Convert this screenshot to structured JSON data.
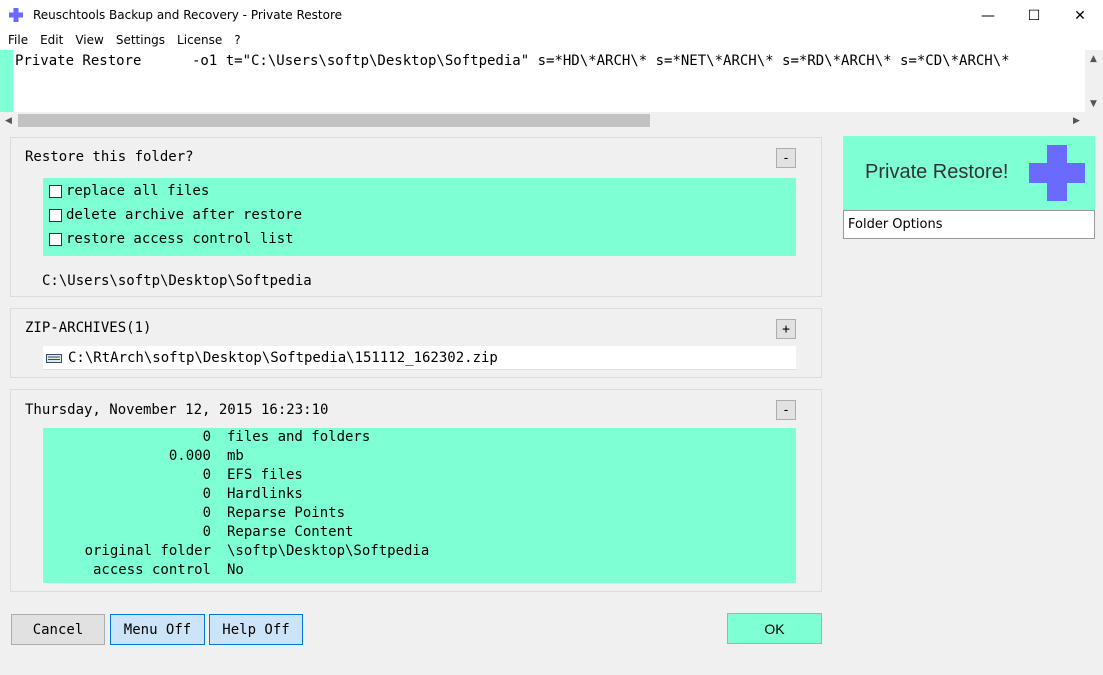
{
  "window": {
    "title": "Reuschtools Backup and Recovery - Private Restore",
    "minimize": "—",
    "maximize": "☐",
    "close": "✕"
  },
  "menu": [
    "File",
    "Edit",
    "View",
    "Settings",
    "License",
    "?"
  ],
  "command": {
    "text": "Private Restore      -o1 t=\"C:\\Users\\softp\\Desktop\\Softpedia\" s=*HD\\*ARCH\\* s=*NET\\*ARCH\\* s=*RD\\*ARCH\\* s=*CD\\*ARCH\\*"
  },
  "restore_panel": {
    "title": "Restore this folder?",
    "toggle": "-",
    "options": [
      {
        "label": "replace all files",
        "checked": false
      },
      {
        "label": "delete archive after restore",
        "checked": false
      },
      {
        "label": "restore access control list",
        "checked": false
      }
    ],
    "path": "C:\\Users\\softp\\Desktop\\Softpedia"
  },
  "zip_panel": {
    "title": "ZIP-ARCHIVES(1)",
    "toggle": "+",
    "item": "C:\\RtArch\\softp\\Desktop\\Softpedia\\151112_162302.zip"
  },
  "stats_panel": {
    "title": "Thursday, November 12, 2015  16:23:10",
    "toggle": "-",
    "rows": [
      {
        "value": "0",
        "label": "files and folders"
      },
      {
        "value": "0.000",
        "label": "mb"
      },
      {
        "value": "0",
        "label": "EFS files"
      },
      {
        "value": "0",
        "label": "Hardlinks"
      },
      {
        "value": "0",
        "label": "Reparse Points"
      },
      {
        "value": "0",
        "label": "Reparse Content"
      },
      {
        "value": "original folder",
        "label": "\\softp\\Desktop\\Softpedia"
      },
      {
        "value": "access control",
        "label": "No"
      }
    ]
  },
  "buttons": {
    "cancel": "Cancel",
    "menu_off": "Menu Off",
    "help_off": "Help Off",
    "ok": "OK"
  },
  "sidebar": {
    "title": "Private Restore!",
    "folder_options": "Folder Options"
  },
  "colors": {
    "accent": "#7fffd4",
    "icon": "#6a6aff"
  }
}
